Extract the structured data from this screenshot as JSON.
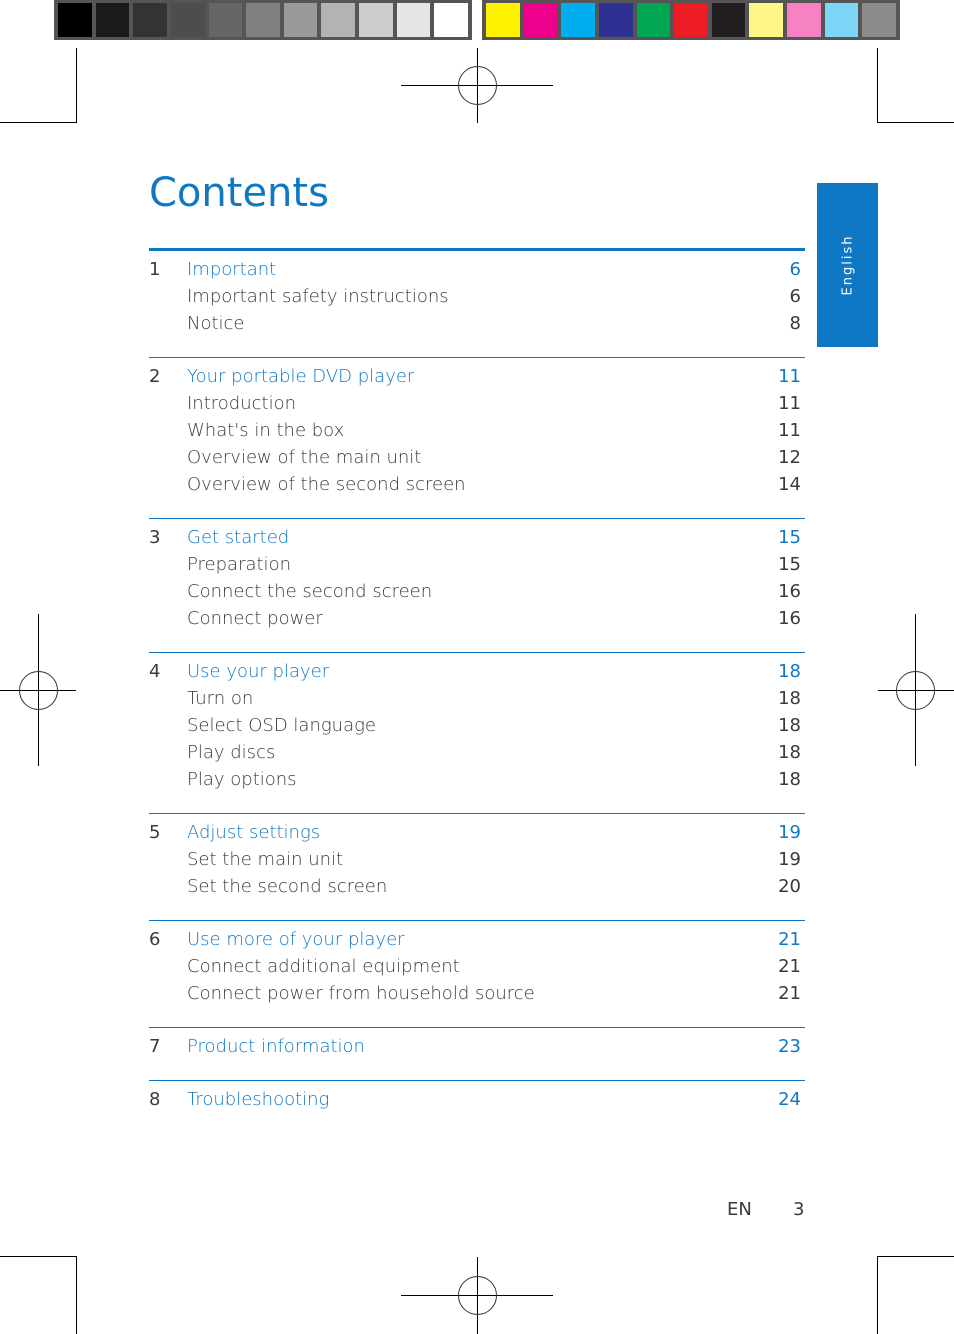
{
  "color_bars": {
    "grayscale": [
      "#000000",
      "#1a1a1a",
      "#333333",
      "#4d4d4d",
      "#666666",
      "#808080",
      "#999999",
      "#b3b3b3",
      "#cccccc",
      "#e6e6e6",
      "#ffffff"
    ],
    "process": [
      "#fff200",
      "#ec008c",
      "#00aeef",
      "#2e3192",
      "#00a651",
      "#ed1c24",
      "#231f20",
      "#fff685",
      "#f682c4",
      "#7dd5f7",
      "#8c8c8c"
    ]
  },
  "accent_color": "#0e78c4",
  "language_tab": "English",
  "title": "Contents",
  "sections": [
    {
      "num": "1",
      "title": "Important",
      "page": "6",
      "items": [
        {
          "label": "Important safety instructions",
          "page": "6"
        },
        {
          "label": "Notice",
          "page": "8"
        }
      ]
    },
    {
      "num": "2",
      "title": "Your portable DVD player",
      "page": "11",
      "items": [
        {
          "label": "Introduction",
          "page": "11"
        },
        {
          "label": "What's in the box",
          "page": "11"
        },
        {
          "label": "Overview of the main unit",
          "page": "12"
        },
        {
          "label": "Overview of the second screen",
          "page": "14"
        }
      ]
    },
    {
      "num": "3",
      "title": "Get started",
      "page": "15",
      "items": [
        {
          "label": "Preparation",
          "page": "15"
        },
        {
          "label": "Connect the second screen",
          "page": "16"
        },
        {
          "label": "Connect power",
          "page": "16"
        }
      ]
    },
    {
      "num": "4",
      "title": "Use your player",
      "page": "18",
      "items": [
        {
          "label": "Turn on",
          "page": "18"
        },
        {
          "label": "Select OSD language",
          "page": "18"
        },
        {
          "label": "Play discs",
          "page": "18"
        },
        {
          "label": "Play options",
          "page": "18"
        }
      ]
    },
    {
      "num": "5",
      "title": "Adjust settings",
      "page": "19",
      "items": [
        {
          "label": "Set the main unit",
          "page": "19"
        },
        {
          "label": "Set the second screen",
          "page": "20"
        }
      ]
    },
    {
      "num": "6",
      "title": "Use more of your player",
      "page": "21",
      "items": [
        {
          "label": "Connect additional equipment",
          "page": "21"
        },
        {
          "label": "Connect power from household source",
          "page": "21"
        }
      ]
    },
    {
      "num": "7",
      "title": "Product information",
      "page": "23",
      "items": []
    },
    {
      "num": "8",
      "title": "Troubleshooting",
      "page": "24",
      "items": []
    }
  ],
  "footer": {
    "lang_code": "EN",
    "page_number": "3"
  }
}
